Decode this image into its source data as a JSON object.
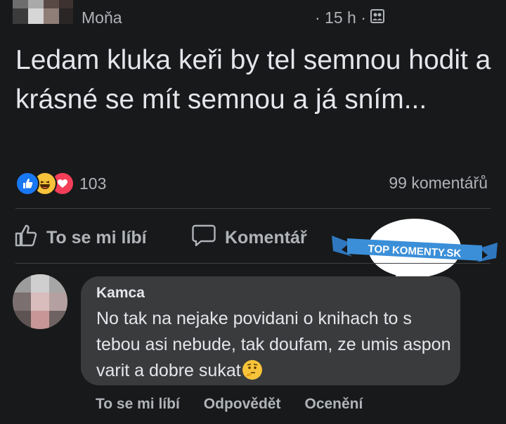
{
  "post": {
    "author": "Moňa",
    "time": "· 15 h ·",
    "audience_icon": "friends-icon",
    "text": "Ledam kluka keři by tel semnou hodit a krásné se mít semnou a já sním..."
  },
  "stats": {
    "reaction_icons": [
      "like-reaction-icon",
      "haha-reaction-icon",
      "love-reaction-icon"
    ],
    "reaction_count": "103",
    "comments_count": "99 komentářů"
  },
  "actions": {
    "like_label": "To se mi líbí",
    "comment_label": "Komentář"
  },
  "watermark": {
    "text": "TOP KOMENTY.SK",
    "ribbon_color": "#3b8fd8"
  },
  "comment": {
    "author": "Kamca",
    "text": "No tak na nejake povidani o knihach to s tebou asi nebude, tak doufam, ze umis aspon varit a dobre sukat",
    "emoji_icon": "thinking-face-icon",
    "actions": {
      "like": "To se mi líbí",
      "reply": "Odpovědět",
      "rate": "Ocenění"
    }
  },
  "colors": {
    "background": "#18191a",
    "bubble": "#3a3b3c",
    "text": "#e4e6eb",
    "secondary_text": "#b0b3b8"
  }
}
